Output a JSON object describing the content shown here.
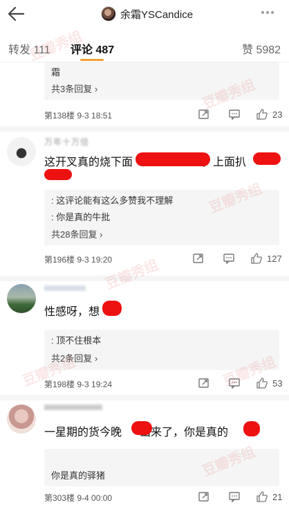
{
  "header": {
    "title": "余霜YSCandice",
    "back_icon": "back-arrow-icon",
    "more_icon": "more-dots-icon"
  },
  "tabs": {
    "repost_label": "转发 111",
    "comments_label": "评论 487",
    "likes_label": "赞 5982",
    "accent": "#f0a030"
  },
  "comments": [
    {
      "text": "霜",
      "more_replies": "共3条回复 ›",
      "floor": "第138楼  9-3 18:51",
      "likes": "23"
    },
    {
      "username": "万年十万倍",
      "text_a": "这开叉真的烧下面",
      "text_b": "，上面扒",
      "replies": [
        {
          "who": "                ",
          "text": ": 这评论能有这么多赞我不理解"
        },
        {
          "who": "          ",
          "text": ": 你是真的牛批"
        }
      ],
      "more_replies": "共28条回复 ›",
      "floor": "第196楼  9-3 19:20",
      "likes": "127"
    },
    {
      "username": "",
      "text": "性感呀，想",
      "replies": [
        {
          "who": "              ",
          "text": ": 顶不住根本"
        }
      ],
      "more_replies": "共2条回复 ›",
      "floor": "第198楼  9-3 19:24",
      "likes": "53"
    },
    {
      "username": "",
      "text_a": "一星期的货今晚",
      "text_b": "出来了，你是真的",
      "replies": [
        {
          "who": "                    ",
          "text": ""
        },
        {
          "who": "          ",
          "text": "你是真的驿猪"
        }
      ],
      "floor": "第303楼  9-4 00:00",
      "likes": "21"
    }
  ],
  "watermark": "豆瓣秀组",
  "colors": {
    "redaction": "#ee1111",
    "reply_bg": "#f5f5f5"
  }
}
